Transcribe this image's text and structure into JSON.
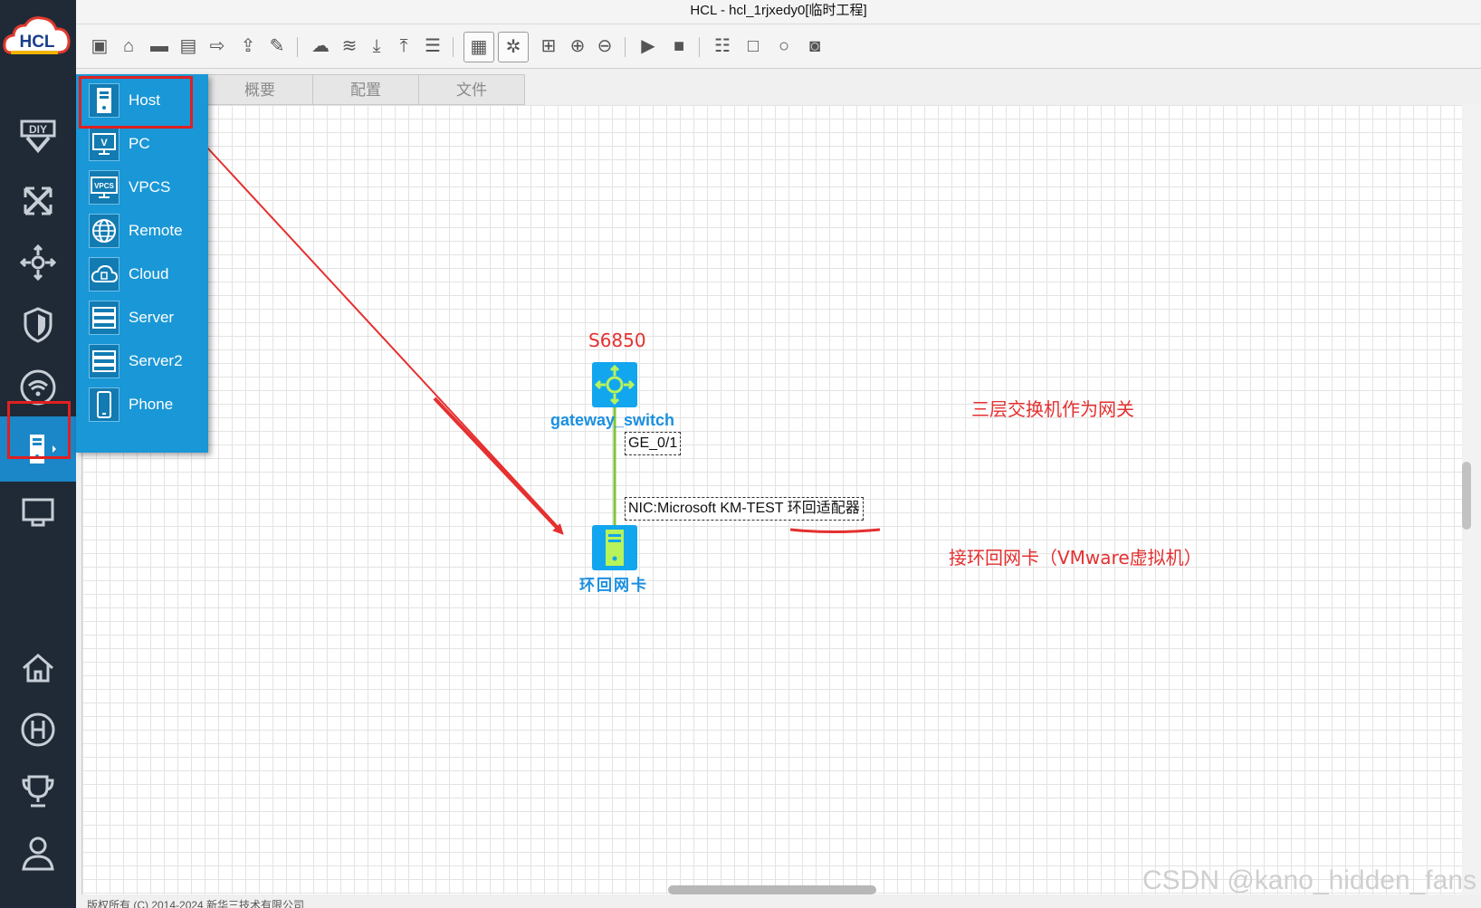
{
  "window": {
    "title": "HCL - hcl_1rjxedy0[临时工程]"
  },
  "logo": {
    "text": "HCL"
  },
  "toolbar": {
    "buttons": [
      "new-project-icon",
      "open-folder-icon",
      "open-project-icon",
      "save-icon",
      "save-as-icon",
      "export-icon",
      "edit-icon",
      "cloud-icon",
      "layers-icon",
      "download-icon",
      "upload-icon",
      "log-icon",
      "topology-view-icon",
      "settings-view-icon",
      "grid-view-icon",
      "zoom-in-icon",
      "zoom-out-icon",
      "start-icon",
      "stop-icon",
      "add-note-icon",
      "add-rect-icon",
      "add-ellipse-icon",
      "screenshot-icon"
    ]
  },
  "sidebar": {
    "items": [
      "diy-icon",
      "router-icon",
      "switch-icon",
      "firewall-icon",
      "wireless-icon",
      "terminal-icon",
      "link-icon",
      "home-icon",
      "help-icon",
      "trophy-icon",
      "user-icon"
    ]
  },
  "tabs": [
    {
      "label": "概要"
    },
    {
      "label": "配置"
    },
    {
      "label": "文件"
    }
  ],
  "device_menu": {
    "items": [
      {
        "label": "Host",
        "icon": "host-icon"
      },
      {
        "label": "PC",
        "icon": "pc-icon"
      },
      {
        "label": "VPCS",
        "icon": "vpcs-icon"
      },
      {
        "label": "Remote",
        "icon": "remote-globe-icon"
      },
      {
        "label": "Cloud",
        "icon": "cloud-device-icon"
      },
      {
        "label": "Server",
        "icon": "server-icon"
      },
      {
        "label": "Server2",
        "icon": "server2-icon"
      },
      {
        "label": "Phone",
        "icon": "phone-icon"
      }
    ],
    "vpcs_icon_text": "VPCS",
    "pc_icon_text": "V"
  },
  "topology": {
    "switch": {
      "model": "S6850",
      "name": "gateway_switch"
    },
    "host": {
      "name": "环回网卡"
    },
    "link": {
      "switch_port": "GE_0/1",
      "host_port": "NIC:Microsoft KM-TEST 环回适配器"
    },
    "colors": {
      "link": "#7ec63b",
      "device": "#12a6ef",
      "annotation": "#e53030"
    }
  },
  "annotations": {
    "gateway_note": "三层交换机作为网关",
    "nic_note": "接环回网卡（VMware虚拟机）"
  },
  "status": {
    "copyright": "版权所有 (C) 2014-2024 新华三技术有限公司"
  },
  "watermark": "CSDN @kano_hidden_fans"
}
